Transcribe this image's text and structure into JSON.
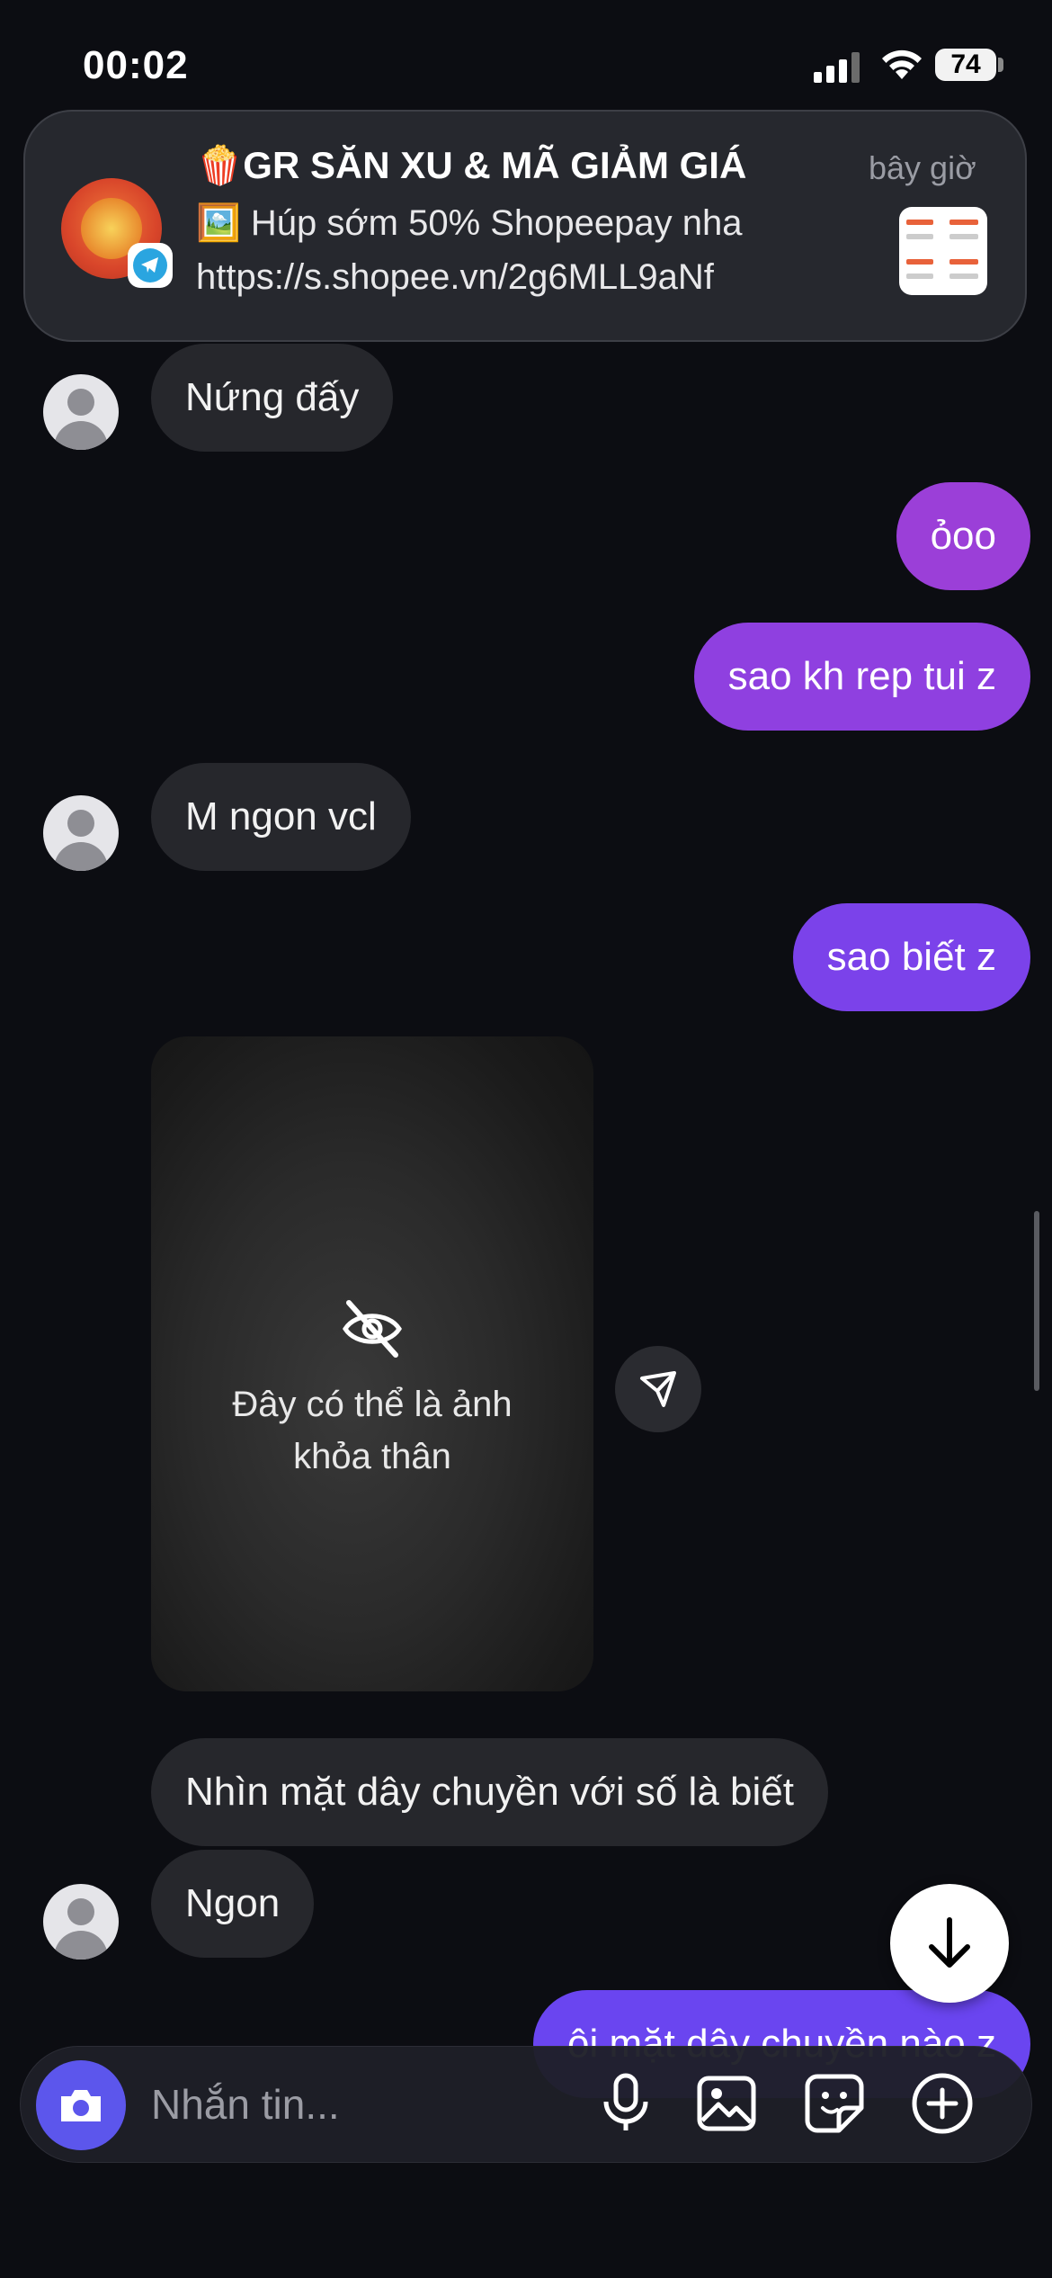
{
  "status_bar": {
    "time": "00:02",
    "battery": "74"
  },
  "notification": {
    "title": "🍿GR SĂN XU & MÃ GIẢM GIÁ",
    "line1": "🖼️ Húp sớm 50% Shopeepay nha",
    "line2": "https://s.shopee.vn/2g6MLL9aNf",
    "time": "bây giờ"
  },
  "messages": [
    {
      "side": "in",
      "text": "Nứng đấy"
    },
    {
      "side": "out",
      "text": "ỏoo"
    },
    {
      "side": "out",
      "text": "sao kh rep tui z"
    },
    {
      "side": "in",
      "text": "M ngon vcl"
    },
    {
      "side": "out",
      "text": "sao biết z"
    },
    {
      "side": "in",
      "text": "Nhìn mặt dây chuyền với số là biết"
    },
    {
      "side": "in",
      "text": "Ngon"
    },
    {
      "side": "out",
      "text": "ôi mặt dây chuyền nào z"
    }
  ],
  "sensitive_image": {
    "line1": "Đây có thể là ảnh",
    "line2": "khỏa thân"
  },
  "composer": {
    "placeholder": "Nhắn tin..."
  },
  "colors": {
    "out_bubble_top": "#9b3fd8",
    "out_bubble_bottom": "#6a45f0",
    "in_bubble": "#26272c",
    "camera": "#5c56ec"
  }
}
